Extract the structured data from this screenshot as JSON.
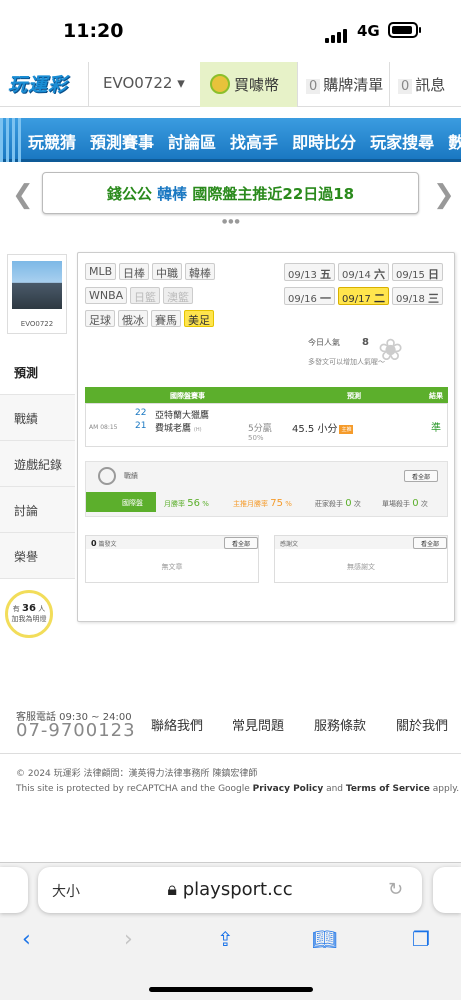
{
  "status": {
    "time": "11:20",
    "network": "4G"
  },
  "topbar": {
    "logo": "玩運彩",
    "user": "EVO0722 ▾",
    "coins": "買噱幣",
    "buylist_count": "0",
    "buylist": "購牌清單",
    "msg_count": "0",
    "msgs": "訊息"
  },
  "nav": [
    "玩競猜",
    "預測賽事",
    "討論區",
    "找高手",
    "即時比分",
    "玩家搜尋",
    "數據"
  ],
  "banner": {
    "part1": "錢公公",
    "part2": "韓棒",
    "part3": "國際盤主推近22日過18"
  },
  "sidebar": {
    "username": "EVO0722",
    "items": [
      "預測",
      "戰績",
      "遊戲紀錄",
      "討論",
      "榮譽"
    ],
    "fans_prefix": "有",
    "fans_count": "36",
    "fans_suffix": "人",
    "fans_label": "加我為明燈"
  },
  "leagues": [
    "MLB",
    "日棒",
    "中職",
    "韓棒",
    "WNBA",
    "日籃",
    "澳籃",
    "足球",
    "俄冰",
    "賽馬",
    "美足"
  ],
  "dates": [
    {
      "d": "09/13",
      "w": "五"
    },
    {
      "d": "09/14",
      "w": "六"
    },
    {
      "d": "09/15",
      "w": "日"
    },
    {
      "d": "09/16",
      "w": "一"
    },
    {
      "d": "09/17",
      "w": "二"
    },
    {
      "d": "09/18",
      "w": "三"
    }
  ],
  "popularity": {
    "label": "今日人氣",
    "value": "8",
    "hint": "多發文可以增加人氣喔～"
  },
  "game_table": {
    "headers": [
      "國際盤賽事",
      "預測",
      "結果"
    ],
    "time": "AM 08:15",
    "away_no": "22",
    "away": "亞特蘭大獵鷹",
    "home_no": "21",
    "home": "費城老鷹",
    "home_tag": "(H)",
    "spread": "5分贏",
    "spread_pct": "50%",
    "pick": "45.5 小分",
    "pick_tag": "主推",
    "result": "準"
  },
  "record": {
    "title": "戰績",
    "all": "看全部",
    "category": "國際盤",
    "win_rate_label": "月勝率",
    "win_rate": "56",
    "main_rate_label": "主推月勝率",
    "main_rate": "75",
    "kill_label": "莊家殺手",
    "kill": "0",
    "single_label": "單場殺手",
    "single": "0",
    "pct": "%",
    "unit": "次"
  },
  "posts": {
    "count": "0",
    "label": "篇發文",
    "all": "看全部",
    "empty": "無文章"
  },
  "thanks": {
    "label": "感謝文",
    "all": "看全部",
    "empty": "無感謝文"
  },
  "footer": {
    "svc": "客服電話 09:30 ~ 24:00",
    "phone": "07-9700123",
    "links": [
      "聯絡我們",
      "常見問題",
      "服務條款",
      "關於我們"
    ],
    "copy": "© 2024 玩運彩 法律顧問：漢英得力法律事務所 陳鎮宏律師",
    "rc1": "This site is protected by reCAPTCHA and the Google ",
    "pp": "Privacy Policy",
    "and": " and ",
    "tos": "Terms of Service",
    "rc2": " apply."
  },
  "safari": {
    "aa": "大小",
    "url": "playsport.cc"
  }
}
